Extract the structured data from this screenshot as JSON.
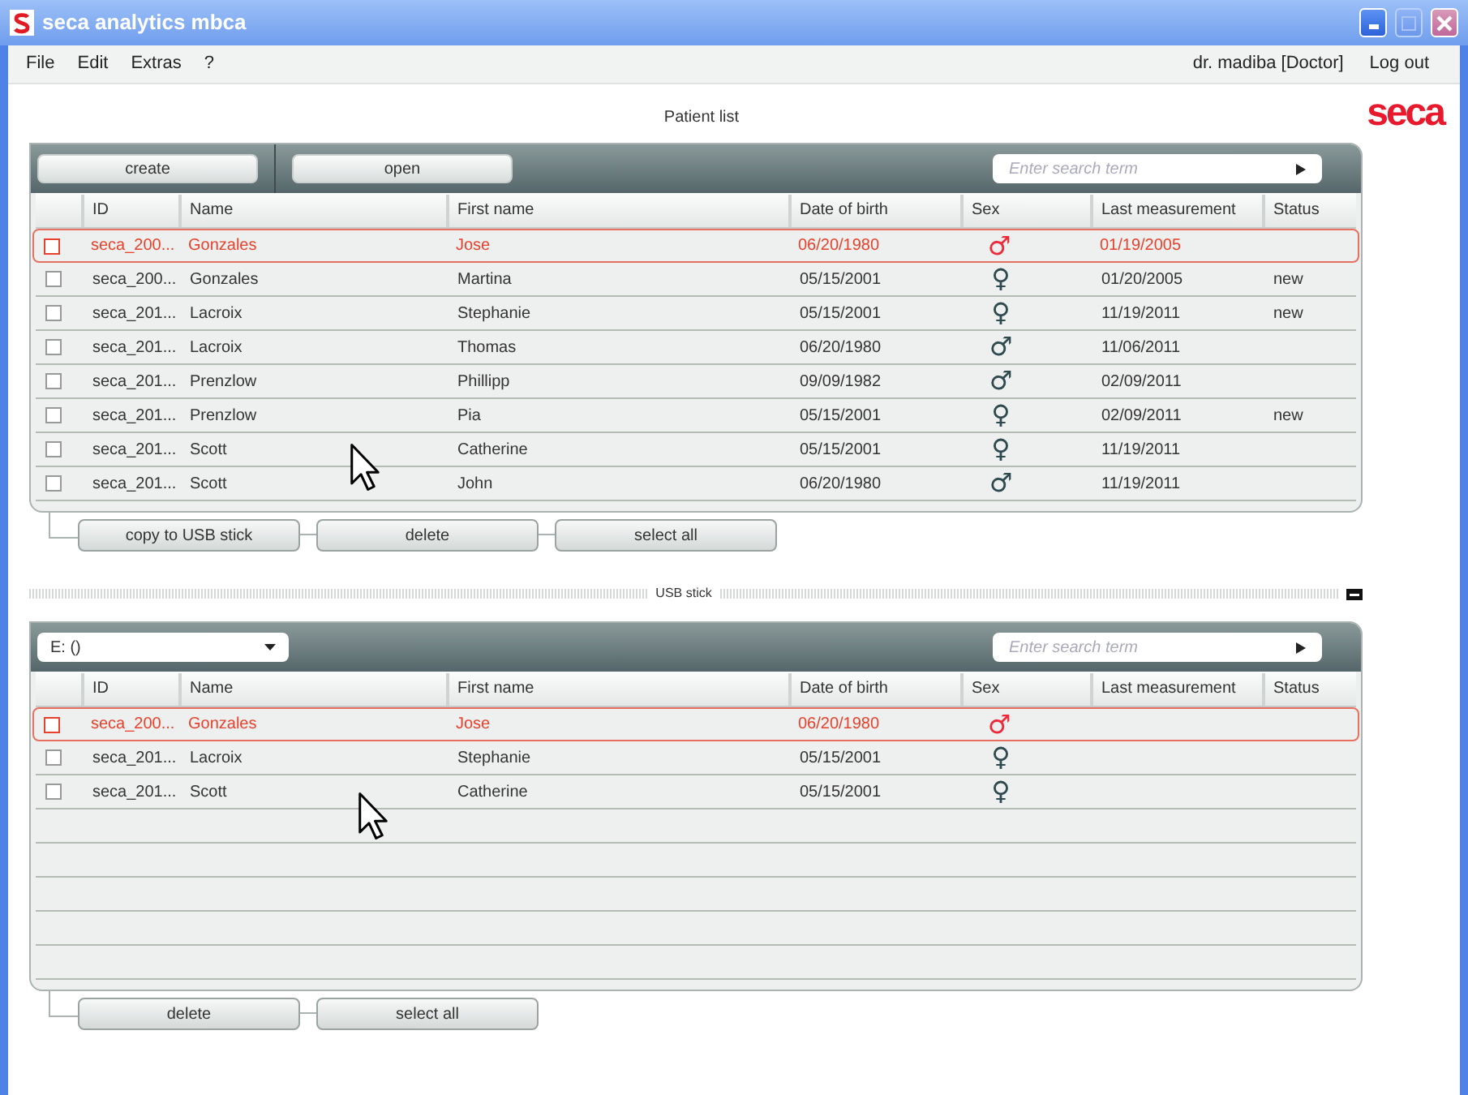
{
  "window": {
    "title": "seca analytics mbca"
  },
  "menu": [
    "File",
    "Edit",
    "Extras",
    "?"
  ],
  "user": "dr. madiba [Doctor]",
  "logout": "Log out",
  "logo": "seca",
  "page_title": "Patient list",
  "patients": {
    "toolbar_buttons": [
      "create",
      "open"
    ],
    "search": {
      "placeholder": "Enter search term"
    },
    "columns": [
      "ID",
      "Name",
      "First name",
      "Date of birth",
      "Sex",
      "Last measurement",
      "Status"
    ],
    "rows": [
      {
        "id": "seca_200...",
        "name": "Gonzales",
        "first_name": "Jose",
        "date_of_birth": "06/20/1980",
        "sex": "♂",
        "last_measurement": "01/19/2005",
        "selected": true,
        "checked": false
      },
      {
        "id": "seca_200...",
        "name": "Gonzales",
        "first_name": "Martina",
        "date_of_birth": "05/15/2001",
        "sex": "♀",
        "last_measurement": "01/20/2005",
        "status": "new",
        "selected": false,
        "checked": false
      },
      {
        "id": "seca_201...",
        "name": "Lacroix",
        "first_name": "Stephanie",
        "date_of_birth": "05/15/2001",
        "sex": "♀",
        "last_measurement": "11/19/2011",
        "status": "new",
        "selected": false,
        "checked": false
      },
      {
        "id": "seca_201...",
        "name": "Lacroix",
        "first_name": "Thomas",
        "date_of_birth": "06/20/1980",
        "sex": "♂",
        "last_measurement": "11/06/2011",
        "selected": false,
        "checked": false
      },
      {
        "id": "seca_201...",
        "name": "Prenzlow",
        "first_name": "Phillipp",
        "date_of_birth": "09/09/1982",
        "sex": "♂",
        "last_measurement": "02/09/2011",
        "selected": false,
        "checked": false
      },
      {
        "id": "seca_201...",
        "name": "Prenzlow",
        "first_name": "Pia",
        "date_of_birth": "05/15/2001",
        "sex": "♀",
        "last_measurement": "02/09/2011",
        "status": "new",
        "selected": false,
        "checked": false
      },
      {
        "id": "seca_201...",
        "name": "Scott",
        "first_name": "Catherine",
        "date_of_birth": "05/15/2001",
        "sex": "♀",
        "last_measurement": "11/19/2011",
        "selected": false,
        "checked": false
      },
      {
        "id": "seca_201...",
        "name": "Scott",
        "first_name": "John",
        "date_of_birth": "06/20/1980",
        "sex": "♂",
        "last_measurement": "11/19/2011",
        "selected": false,
        "checked": false
      }
    ],
    "actions": [
      "copy to USB stick",
      "delete",
      "select all"
    ]
  },
  "usb_divider": {
    "label": "USB stick"
  },
  "usb": {
    "drive": "E: ()",
    "search": {
      "placeholder": "Enter search term"
    },
    "columns": [
      "ID",
      "Name",
      "First name",
      "Date of birth",
      "Sex",
      "Last measurement",
      "Status"
    ],
    "rows": [
      {
        "id": "seca_200...",
        "name": "Gonzales",
        "first_name": "Jose",
        "date_of_birth": "06/20/1980",
        "sex": "♂",
        "selected": true,
        "checked": false
      },
      {
        "id": "seca_201...",
        "name": "Lacroix",
        "first_name": "Stephanie",
        "date_of_birth": "05/15/2001",
        "sex": "♀",
        "selected": false,
        "checked": false
      },
      {
        "id": "seca_201...",
        "name": "Scott",
        "first_name": "Catherine",
        "date_of_birth": "05/15/2001",
        "sex": "♀",
        "selected": false,
        "checked": false
      }
    ],
    "actions": [
      "delete",
      "select all"
    ]
  }
}
